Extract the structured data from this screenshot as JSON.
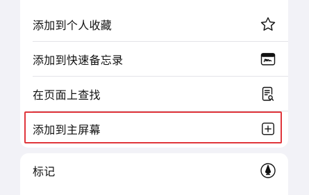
{
  "menu": {
    "items": [
      {
        "label": "添加到个人收藏",
        "icon": "star-icon"
      },
      {
        "label": "添加到快速备忘录",
        "icon": "quick-note-icon"
      },
      {
        "label": "在页面上查找",
        "icon": "find-on-page-icon"
      },
      {
        "label": "添加到主屏幕",
        "icon": "add-square-icon",
        "highlighted": true
      }
    ],
    "secondary_items": [
      {
        "label": "标记",
        "icon": "markup-pen-icon"
      }
    ]
  },
  "colors": {
    "highlight": "#e0353b",
    "background": "#f2f2f7",
    "card": "#ffffff"
  }
}
